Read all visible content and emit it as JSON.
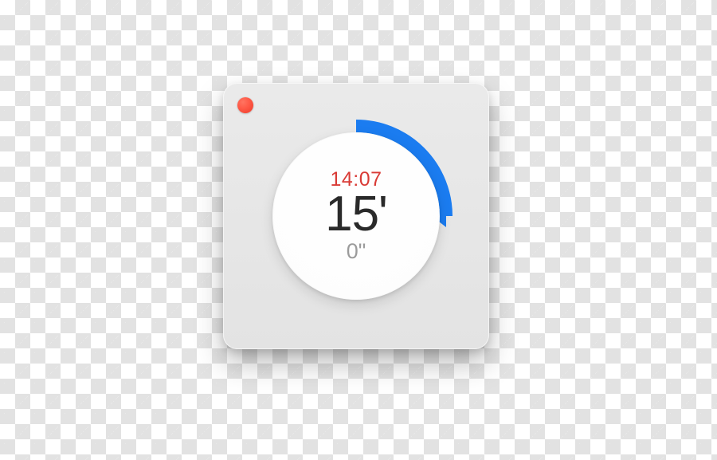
{
  "timer": {
    "end_time": "14:07",
    "minutes_display": "15'",
    "seconds_display": "0\"",
    "fraction": 0.25,
    "start_angle_deg": 0,
    "sweep_deg": 90
  },
  "colors": {
    "accent": "#1b7cf0",
    "red_dot": "#ff5b48",
    "time_text": "#d93b36",
    "minutes_text": "#2a2a2a",
    "seconds_text": "#9b9b9b",
    "card_bg": "#e7e7e7"
  },
  "icons": {
    "close": "window-close-dot"
  }
}
